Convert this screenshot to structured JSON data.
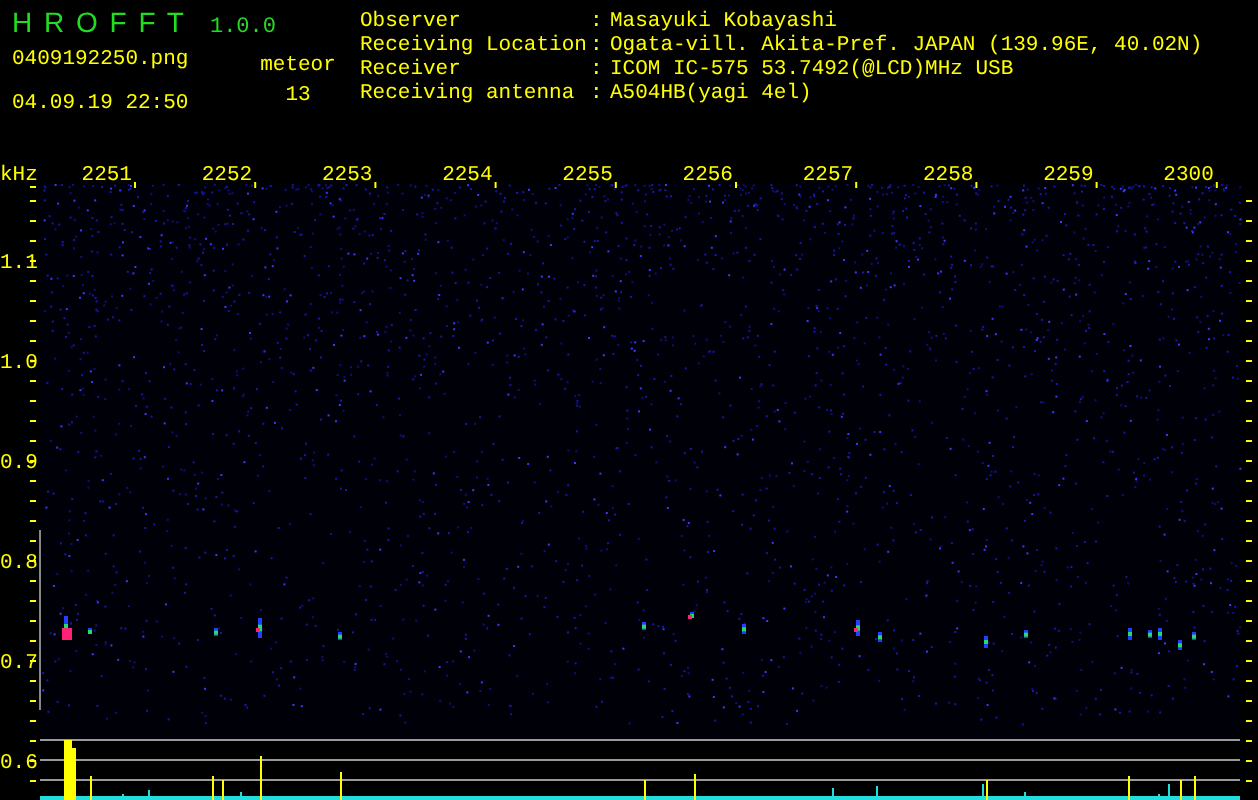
{
  "app": {
    "title": "H R O F F T",
    "version": "1.0.0",
    "filename": "0409192250.png",
    "datetime": "04.09.19 22:50",
    "counter_label": "meteor",
    "counter_value": "13"
  },
  "info": [
    {
      "label": "Observer",
      "separator": ":",
      "value": "Masayuki Kobayashi"
    },
    {
      "label": "Receiving Location",
      "separator": ":",
      "value": "Ogata-vill. Akita-Pref. JAPAN (139.96E, 40.02N)"
    },
    {
      "label": "Receiver",
      "separator": ":",
      "value": "ICOM IC-575 53.7492(@LCD)MHz USB"
    },
    {
      "label": "Receiving antenna",
      "separator": ":",
      "value": "A504HB(yagi 4el)"
    }
  ],
  "axis": {
    "unit": "kHz",
    "time_labels": [
      "2251",
      "2252",
      "2253",
      "2254",
      "2255",
      "2256",
      "2257",
      "2258",
      "2259",
      "2300"
    ],
    "frequency_labels": [
      "1.1",
      "1.0",
      "0.9",
      "0.8",
      "0.7",
      "0.6"
    ]
  }
}
